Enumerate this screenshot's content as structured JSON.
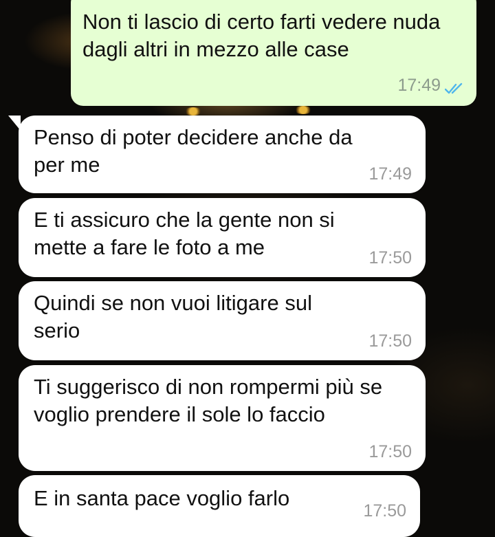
{
  "conversation": {
    "outgoing": [
      {
        "text": "Non ti lascio di certo farti vedere nuda dagli altri in mezzo alle case",
        "time": "17:49",
        "status_icon": "double-check-read-icon"
      }
    ],
    "incoming": [
      {
        "text": "Penso di poter decidere anche da per me",
        "time": "17:49"
      },
      {
        "text": "E ti assicuro che la gente non si mette a fare le foto a me",
        "time": "17:50"
      },
      {
        "text": "Quindi se non vuoi litigare sul serio",
        "time": "17:50"
      },
      {
        "text": "Ti suggerisco di non rompermi più se voglio prendere il sole lo faccio",
        "time": "17:50"
      },
      {
        "text": "E in santa pace voglio farlo",
        "time": "17:50"
      }
    ]
  },
  "colors": {
    "outgoing_bubble": "#e6ffd3",
    "incoming_bubble": "#ffffff",
    "read_ticks": "#4fb6ec",
    "timestamp": "#9a9a9a",
    "wallpaper": "#0b0a08"
  }
}
